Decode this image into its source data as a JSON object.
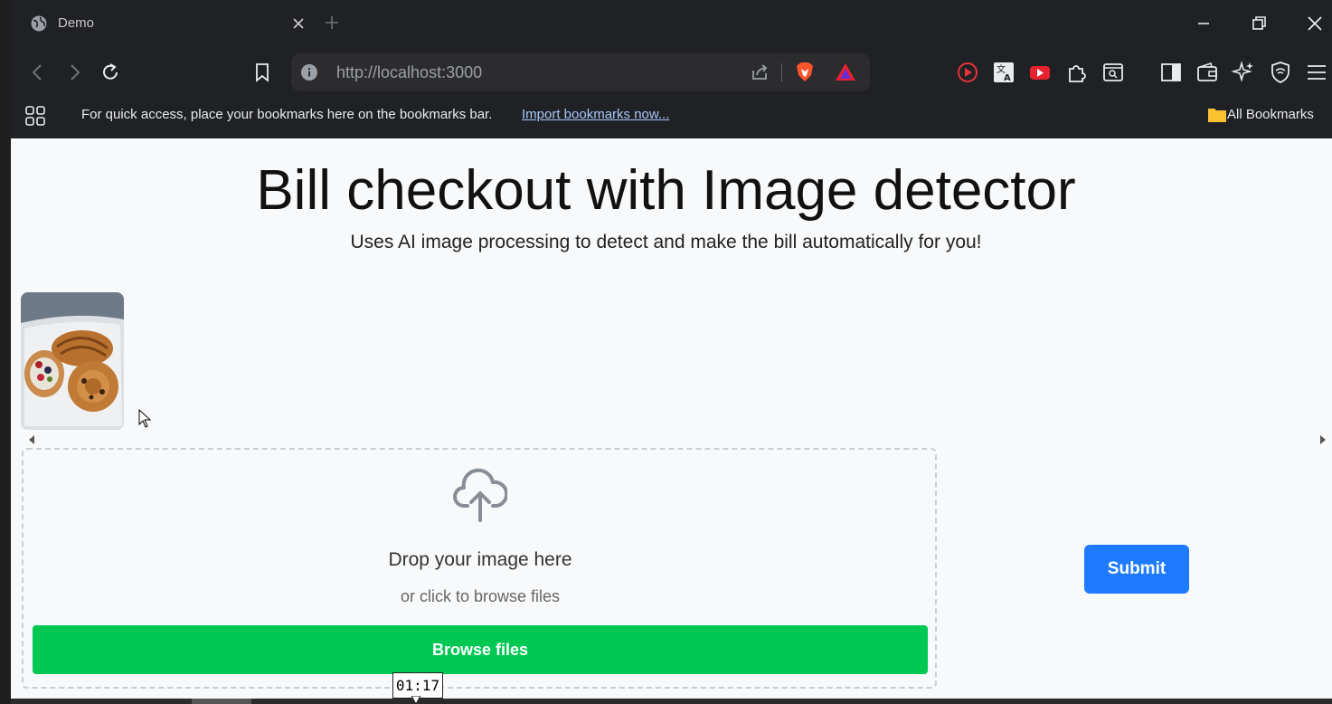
{
  "browser": {
    "tab_title": "Demo",
    "url": "http://localhost:3000",
    "bookmarks_message": "For quick access, place your bookmarks here on the bookmarks bar.",
    "import_link": "Import bookmarks now...",
    "all_bookmarks": "All Bookmarks"
  },
  "page": {
    "title": "Bill checkout with Image detector",
    "subtitle": "Uses AI image processing to detect and make the bill automatically for you!"
  },
  "uploader": {
    "drop_title": "Drop your image here",
    "drop_subtitle": "or click to browse files",
    "browse_label": "Browse files"
  },
  "actions": {
    "submit_label": "Submit"
  },
  "overlay": {
    "timestamp": "01:17"
  },
  "colors": {
    "browse_green": "#00c853",
    "submit_blue": "#1e7bff",
    "page_bg": "#f8f9fa",
    "chrome_bg": "#202124"
  },
  "icons": [
    "globe-icon",
    "close-icon",
    "plus-icon",
    "back-icon",
    "forward-icon",
    "reload-icon",
    "bookmark-icon",
    "info-icon",
    "share-icon",
    "brave-shields-icon",
    "brave-rewards-icon",
    "record-icon",
    "translate-icon",
    "youtube-icon",
    "extensions-icon",
    "reader-icon",
    "sidebar-icon",
    "wallet-icon",
    "leo-ai-icon",
    "vpn-icon",
    "menu-icon",
    "apps-grid-icon",
    "folder-icon",
    "cloud-upload-icon"
  ]
}
